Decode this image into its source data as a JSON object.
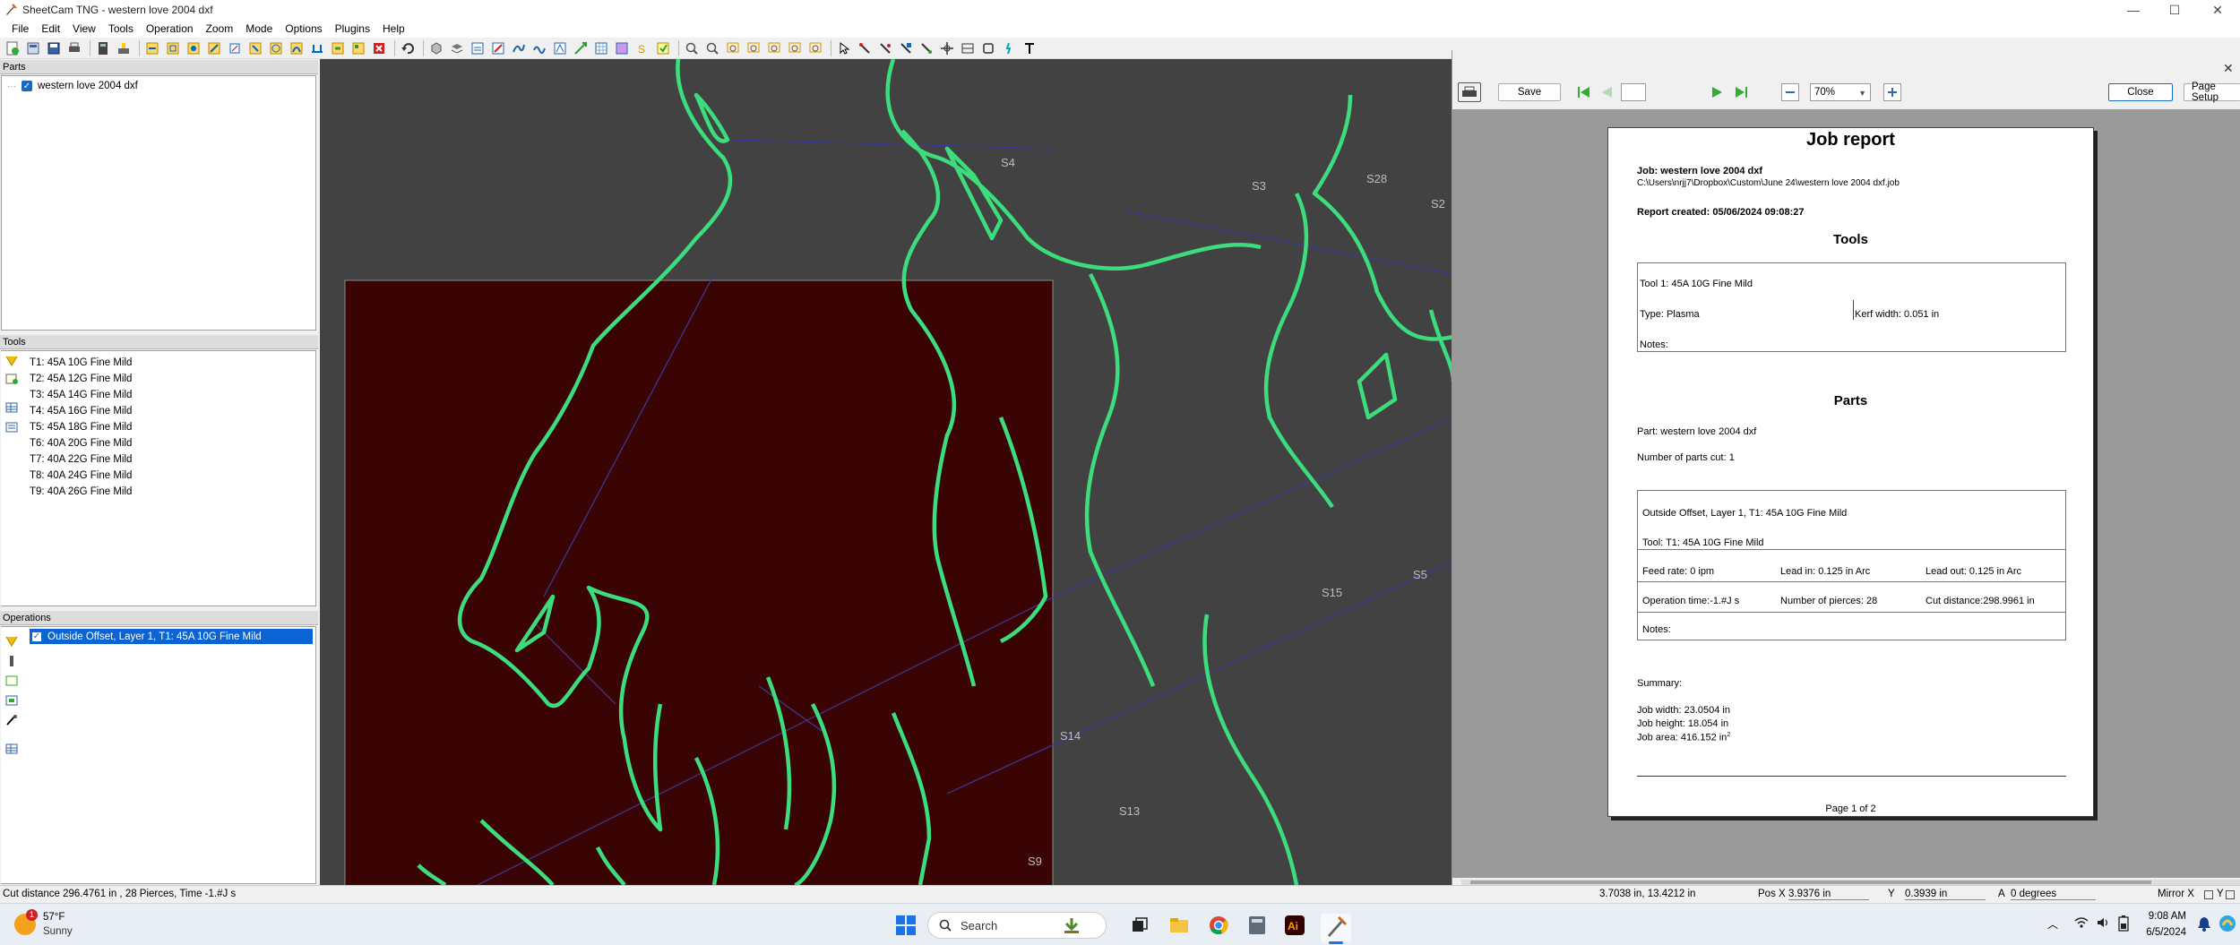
{
  "window": {
    "title": "SheetCam TNG - western love 2004 dxf"
  },
  "menu": [
    "File",
    "Edit",
    "View",
    "Tools",
    "Operation",
    "Zoom",
    "Mode",
    "Options",
    "Plugins",
    "Help"
  ],
  "parts": {
    "header": "Parts",
    "items": [
      {
        "label": "western love 2004 dxf",
        "checked": true
      }
    ]
  },
  "tools": {
    "header": "Tools",
    "items": [
      "T1: 45A 10G Fine Mild",
      "T2: 45A 12G Fine Mild",
      "T3: 45A 14G Fine Mild",
      "T4: 45A 16G Fine Mild",
      "T5: 45A 18G Fine Mild",
      "T6: 40A 20G Fine Mild",
      "T7: 40A 22G Fine Mild",
      "T8: 40A 24G Fine Mild",
      "T9: 40A 26G Fine Mild"
    ]
  },
  "operations": {
    "header": "Operations",
    "items": [
      {
        "label": "Outside Offset, Layer 1, T1: 45A 10G Fine Mild",
        "checked": true,
        "selected": true
      }
    ]
  },
  "canvas": {
    "labels": [
      "S4",
      "S3",
      "S28",
      "S2",
      "S15",
      "S5",
      "S14",
      "S13",
      "S9"
    ],
    "colors": {
      "background": "#424242",
      "stock": "#3b0404",
      "path": "#3ddc7c",
      "rapid": "#3a3aa0"
    }
  },
  "report_toolbar": {
    "save_label": "Save",
    "page_value": "",
    "zoom_value": "70%",
    "close_label": "Close",
    "page_setup_label": "Page Setup"
  },
  "report": {
    "title": "Job report",
    "job_line": "Job: western love 2004 dxf",
    "job_path": "C:\\Users\\nrjj7\\Dropbox\\Custom\\June 24\\western love 2004 dxf.job",
    "created": "Report created: 05/06/2024 09:08:27",
    "tools_heading": "Tools",
    "tool_name": "Tool 1: 45A 10G Fine Mild",
    "tool_type": "Type: Plasma",
    "kerf": "Kerf width: 0.051 in",
    "tool_notes": "Notes:",
    "parts_heading": "Parts",
    "part_name": "Part: western love 2004 dxf",
    "parts_cut": "Number of parts cut: 1",
    "op_name": "Outside Offset, Layer 1, T1: 45A 10G Fine Mild",
    "op_tool": "Tool: T1: 45A 10G Fine Mild",
    "feed": "Feed rate: 0 ipm",
    "lead_in": "Lead in: 0.125 in Arc",
    "lead_out": "Lead out: 0.125 in Arc",
    "op_time": "Operation time:-1.#J s",
    "pierces": "Number of pierces: 28",
    "cut_distance": "Cut distance:298.9961 in",
    "op_notes": "Notes:",
    "summary": "Summary:",
    "job_width": "Job width: 23.0504 in",
    "job_height": "Job height: 18.054 in",
    "job_area": "Job area: 416.152 in",
    "job_area_sup": "2",
    "page_label": "Page 1 of 2"
  },
  "status": {
    "left": "Cut distance 296.4761 in , 28 Pierces, Time -1.#J s",
    "coords": "3.7038 in, 13.4212 in",
    "posx_label": "Pos X",
    "posx_value": "3.9376 in",
    "y_label": "Y",
    "y_value": "0.3939 in",
    "angle_label": "A",
    "angle_value": "0 degrees",
    "mirror_x": "Mirror X",
    "mirror_y": "Y"
  },
  "taskbar": {
    "weather_temp": "57°F",
    "weather_text": "Sunny",
    "weather_badge": "1",
    "search_placeholder": "Search",
    "time": "9:08 AM",
    "date": "6/5/2024"
  }
}
